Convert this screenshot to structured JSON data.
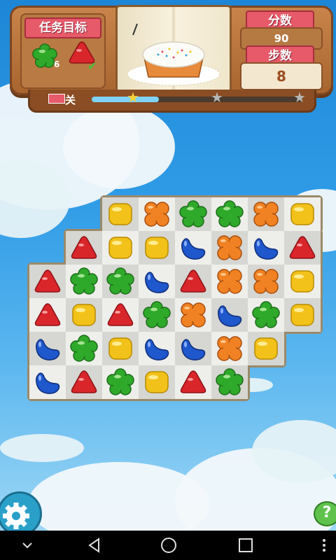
{
  "hud": {
    "goal_title": "任务目标",
    "goals": [
      {
        "candy": "green-flower",
        "count": "6"
      },
      {
        "candy": "red-triangle",
        "count": ""
      }
    ],
    "score_title": "分数",
    "score_value": "90",
    "moves_title": "步数",
    "moves_value": "8",
    "level_label": "关",
    "progress_fraction": 0.32,
    "stars_earned": 1,
    "stars_total": 3
  },
  "board": {
    "grid": [
      [
        null,
        null,
        null,
        "Y",
        "O",
        "G",
        "G",
        "O",
        "Y"
      ],
      [
        null,
        null,
        "R",
        "Y",
        "Y",
        "B",
        "O",
        "B",
        "R"
      ],
      [
        null,
        "R",
        "G",
        "G",
        "B",
        "R",
        "O",
        "O",
        "Y"
      ],
      [
        null,
        "R",
        "Y",
        "R",
        "G",
        "O",
        "B",
        "G",
        "Y"
      ],
      [
        null,
        "B",
        "G",
        "Y",
        "B",
        "B",
        "O",
        "Y",
        null
      ],
      [
        null,
        "B",
        "R",
        "G",
        "Y",
        "R",
        "G",
        null,
        null
      ]
    ],
    "candy_types": {
      "Y": "yellow-square-candy",
      "O": "orange-cross-candy",
      "G": "green-flower-candy",
      "R": "red-triangle-candy",
      "B": "blue-bean-candy"
    },
    "colors": {
      "Y": "#f2c21a",
      "O": "#f08223",
      "G": "#2fa92a",
      "R": "#d9262b",
      "B": "#1f57cc"
    }
  },
  "controls": {
    "help_label": "?",
    "nav": [
      "back-icon",
      "home-icon",
      "recents-icon",
      "menu-icon"
    ]
  }
}
